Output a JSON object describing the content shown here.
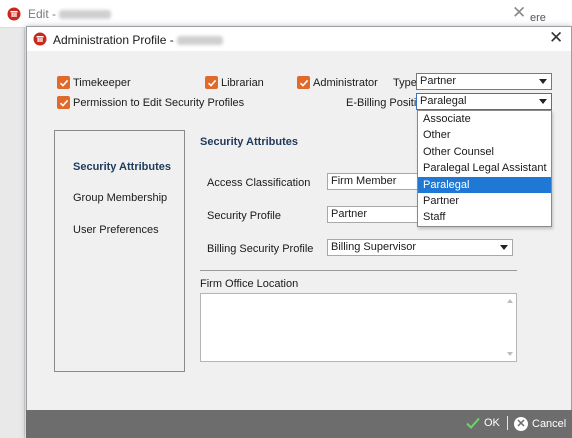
{
  "background_window": {
    "title": "Edit - ",
    "right_text": "ere"
  },
  "dialog": {
    "title": "Administration Profile - "
  },
  "checkboxes": {
    "timekeeper": "Timekeeper",
    "librarian": "Librarian",
    "administrator": "Administrator",
    "permission": "Permission to Edit Security Profiles"
  },
  "type_field": {
    "label": "Type",
    "value": "Partner"
  },
  "ebilling_field": {
    "label": "E-Billing Position",
    "value": "Paralegal",
    "options": [
      "Associate",
      "Other",
      "Other Counsel",
      "Paralegal Legal Assistant",
      "Paralegal",
      "Partner",
      "Staff"
    ],
    "selected": "Paralegal"
  },
  "nav": {
    "items": [
      "Security Attributes",
      "Group Membership",
      "User Preferences"
    ],
    "active": "Security Attributes"
  },
  "security": {
    "title": "Security Attributes",
    "access_label": "Access Classification",
    "access_value": "Firm Member",
    "profile_label": "Security Profile",
    "profile_value": "Partner",
    "billing_label": "Billing Security Profile",
    "billing_value": "Billing Supervisor"
  },
  "firm_office": {
    "label": "Firm Office Location"
  },
  "footer": {
    "ok_label": "OK",
    "cancel_label": "Cancel"
  },
  "colors": {
    "checkbox": "#e06a2b",
    "selection": "#1e78d4",
    "footer": "#6d6d6d",
    "section_title": "#1f3a5a"
  }
}
